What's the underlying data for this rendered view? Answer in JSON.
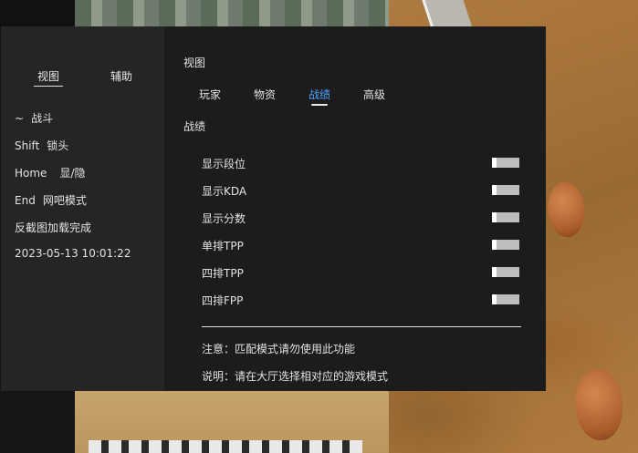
{
  "sidebar": {
    "tabs": [
      {
        "label": "视图",
        "active": true
      },
      {
        "label": "辅助",
        "active": false
      }
    ],
    "hotkeys": [
      {
        "key": "~",
        "action": "战斗"
      },
      {
        "key": "Shift",
        "action": "锁头"
      },
      {
        "key": "Home",
        "action": "显/隐"
      },
      {
        "key": "End",
        "action": "网吧模式"
      }
    ],
    "status": "反截图加载完成",
    "datetime": "2023-05-13 10:01:22"
  },
  "main": {
    "title": "视图",
    "tabs": [
      {
        "label": "玩家",
        "active": false
      },
      {
        "label": "物资",
        "active": false
      },
      {
        "label": "战绩",
        "active": true
      },
      {
        "label": "高级",
        "active": false
      }
    ],
    "section": "战绩",
    "options": [
      {
        "label": "显示段位",
        "on": false
      },
      {
        "label": "显示KDA",
        "on": false
      },
      {
        "label": "显示分数",
        "on": false
      },
      {
        "label": "单排TPP",
        "on": false
      },
      {
        "label": "四排TPP",
        "on": false
      },
      {
        "label": "四排FPP",
        "on": false
      }
    ],
    "notes": [
      "注意：匹配模式请勿使用此功能",
      "说明：请在大厅选择相对应的游戏模式"
    ]
  },
  "colors": {
    "accent": "#4fa3ff",
    "panel": "#1c1c1c",
    "sidebar": "#252525",
    "toggle_track": "#bdbdbd"
  }
}
